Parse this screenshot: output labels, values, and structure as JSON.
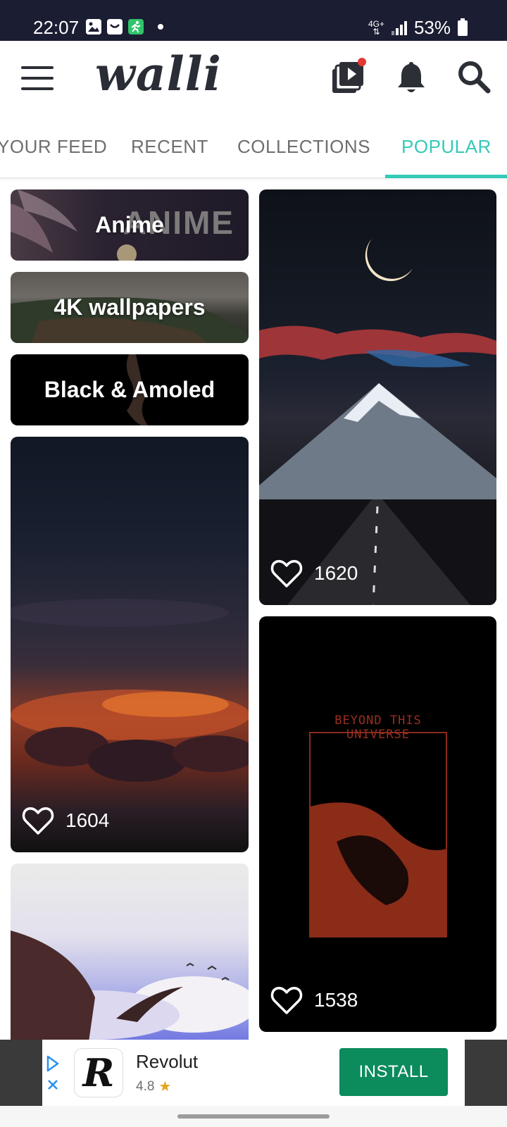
{
  "status_bar": {
    "time": "22:07",
    "network": "4G+",
    "battery": "53%",
    "icons": [
      "gallery-icon",
      "message-icon",
      "running-app-icon",
      "notification-dot",
      "signal-icon",
      "battery-icon"
    ]
  },
  "header": {
    "logo": "walli",
    "icons": [
      "menu-icon",
      "video-collection-icon",
      "bell-icon",
      "search-icon"
    ],
    "notification_dot_color": "#e53935"
  },
  "tabs": [
    {
      "label": "YOUR FEED"
    },
    {
      "label": "RECENT"
    },
    {
      "label": "COLLECTIONS"
    },
    {
      "label": "POPULAR",
      "active": true
    }
  ],
  "accent_color": "#35c9b8",
  "categories": [
    {
      "label": "Anime",
      "bg_text": "ANIME"
    },
    {
      "label": "4K wallpapers"
    },
    {
      "label": "Black & Amoled"
    }
  ],
  "wallpapers": [
    {
      "subject": "crescent moon over snowy mountain and road",
      "likes": "1620"
    },
    {
      "subject": "red cloudy night sky",
      "likes": "1604"
    },
    {
      "subject": "Beyond This Universe poster",
      "poster_text": "BEYOND THIS UNIVERSE",
      "likes": "1538"
    },
    {
      "subject": "dragon over clouds"
    }
  ],
  "ad": {
    "brand": "Revolut",
    "logo_letter": "R",
    "rating": "4.8",
    "cta": "INSTALL",
    "cta_color": "#0c8b5d"
  }
}
